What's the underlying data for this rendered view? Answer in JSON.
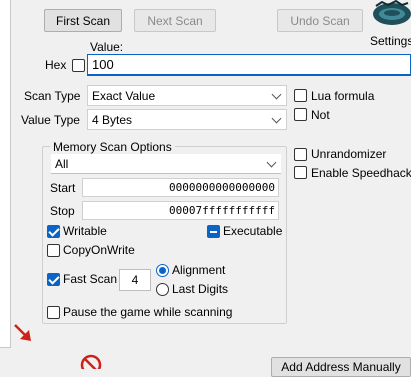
{
  "toolbar": {
    "first_scan": "First Scan",
    "next_scan": "Next Scan",
    "undo_scan": "Undo Scan",
    "settings": "Settings"
  },
  "value_section": {
    "value_label": "Value:",
    "hex_label": "Hex",
    "value": "100"
  },
  "scan_type": {
    "label": "Scan Type",
    "selected": "Exact Value"
  },
  "value_type": {
    "label": "Value Type",
    "selected": "4 Bytes"
  },
  "options_right": {
    "lua_formula": "Lua formula",
    "not": "Not",
    "unrandomizer": "Unrandomizer",
    "enable_speedhack": "Enable Speedhack"
  },
  "memory_scan_options": {
    "title": "Memory Scan Options",
    "region": "All",
    "start_label": "Start",
    "start_value": "0000000000000000",
    "stop_label": "Stop",
    "stop_value": "00007fffffffffff",
    "writable": "Writable",
    "executable": "Executable",
    "copy_on_write": "CopyOnWrite",
    "fast_scan": "Fast Scan",
    "fast_scan_value": "4",
    "alignment": "Alignment",
    "last_digits": "Last Digits",
    "pause_game": "Pause the game while scanning"
  },
  "bottom": {
    "add_address_manually": "Add Address Manually"
  },
  "colors": {
    "accent": "#0a64c8",
    "arrow": "#d0201a"
  }
}
